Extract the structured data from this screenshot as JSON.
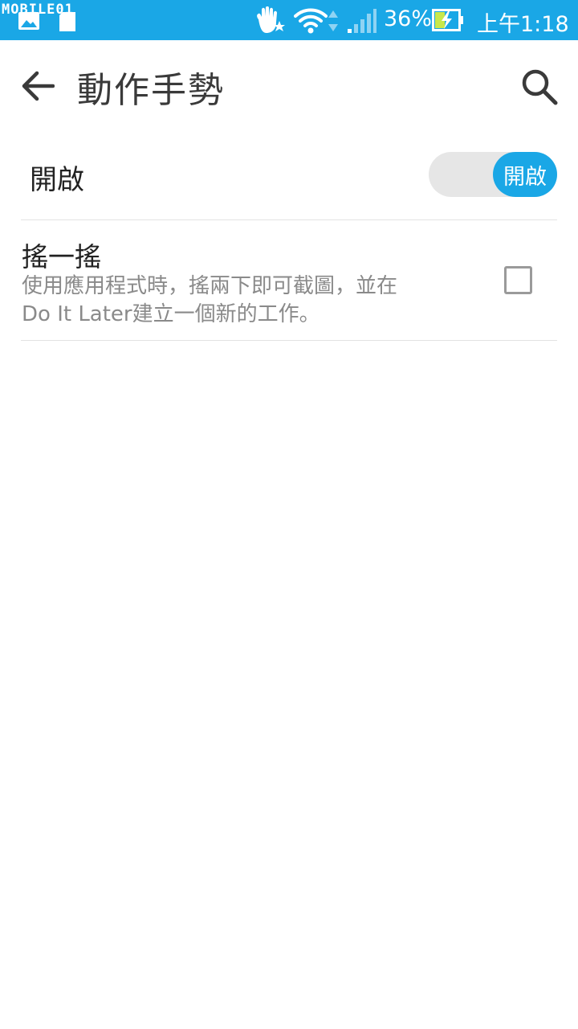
{
  "status_bar": {
    "watermark": "MOBILE01",
    "battery_percent": "36%",
    "time": "上午1:18",
    "background_color": "#1aa7e6",
    "icons": [
      "image-icon",
      "sd-card-icon",
      "gesture-hand-icon",
      "wifi-icon",
      "signal-icon",
      "battery-charging-icon"
    ]
  },
  "app_bar": {
    "title": "動作手勢",
    "back_icon": "arrow-back-icon",
    "search_icon": "search-icon"
  },
  "master_switch": {
    "label": "開啟",
    "toggle_label": "開啟",
    "on": true,
    "accent_color": "#1aa7e6"
  },
  "items": [
    {
      "title": "搖一搖",
      "summary_line1": "使用應用程式時，搖兩下即可截圖，並在",
      "summary_line2": "Do It Later建立一個新的工作。",
      "checked": false
    }
  ]
}
